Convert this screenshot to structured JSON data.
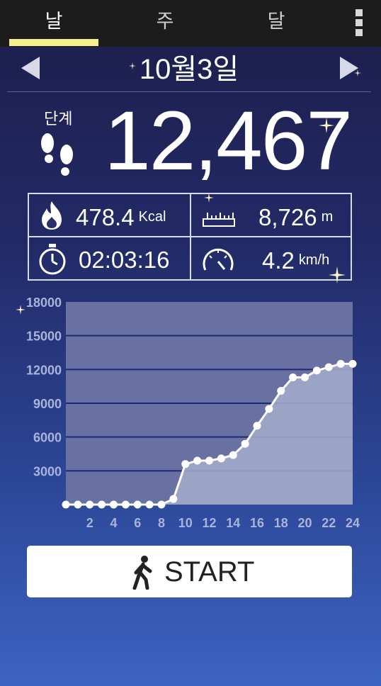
{
  "tabs": [
    {
      "label": "날",
      "active": true
    },
    {
      "label": "주",
      "active": false
    },
    {
      "label": "달",
      "active": false
    }
  ],
  "header": {
    "date": "10월3일",
    "menu_icon": "overflow-menu-icon",
    "prev_icon": "triangle-left-icon",
    "next_icon": "triangle-right-icon"
  },
  "steps": {
    "label": "단계",
    "value": "12,467",
    "icon": "footprints-icon"
  },
  "stats": {
    "calories": {
      "value": "478.4",
      "unit": "Kcal",
      "icon": "flame-icon"
    },
    "distance": {
      "value": "8,726",
      "unit": "m",
      "icon": "ruler-icon"
    },
    "duration": {
      "value": "02:03:16",
      "icon": "stopwatch-icon"
    },
    "speed": {
      "value": "4.2",
      "unit": "km/h",
      "icon": "speedometer-icon"
    }
  },
  "chart_data": {
    "type": "area",
    "x": [
      0,
      1,
      2,
      3,
      4,
      5,
      6,
      7,
      8,
      9,
      10,
      11,
      12,
      13,
      14,
      15,
      16,
      17,
      18,
      19,
      20,
      21,
      22,
      23,
      24
    ],
    "values": [
      0,
      0,
      0,
      0,
      0,
      0,
      0,
      0,
      0,
      500,
      3600,
      3900,
      3900,
      4100,
      4400,
      5400,
      7000,
      8500,
      10100,
      11300,
      11300,
      11900,
      12200,
      12500,
      12500
    ],
    "xticks": [
      "2",
      "4",
      "6",
      "8",
      "10",
      "12",
      "14",
      "16",
      "18",
      "20",
      "22",
      "24"
    ],
    "yticks": [
      "3000",
      "6000",
      "9000",
      "12000",
      "15000",
      "18000"
    ],
    "xlim": [
      0,
      24
    ],
    "ylim": [
      0,
      18000
    ],
    "grid": true
  },
  "start_button": {
    "label": "START",
    "icon": "walking-person-icon"
  },
  "colors": {
    "tab_indicator": "#f4ee8f",
    "chart_fill": "#a6adcc",
    "chart_grid": "#1e2a6e",
    "axis_labels": "#a9b4dc"
  }
}
